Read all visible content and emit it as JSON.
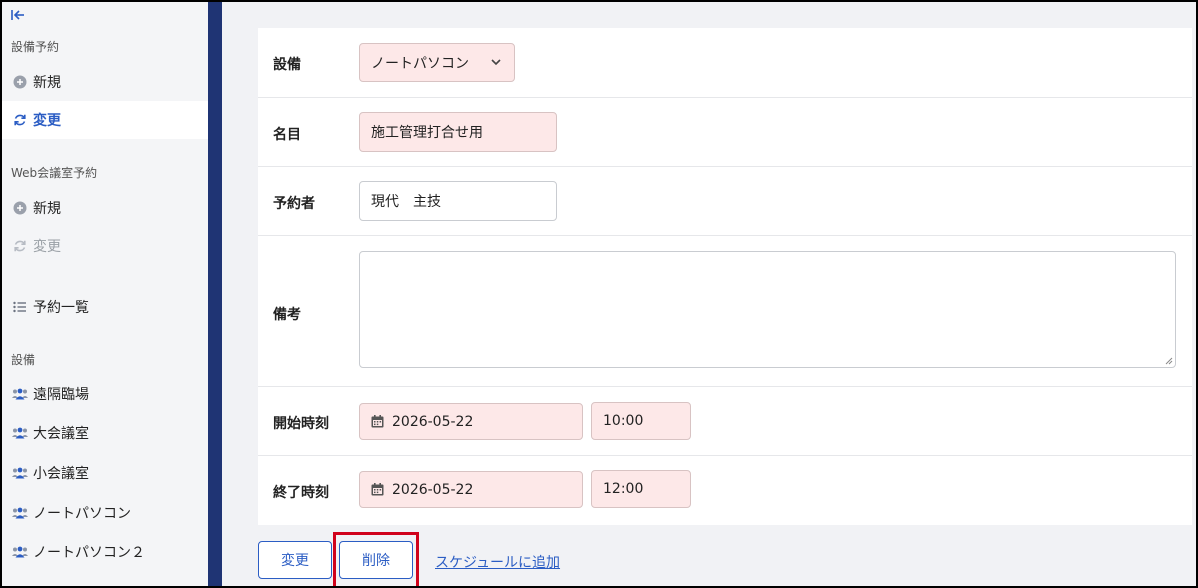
{
  "sidebar": {
    "sections": [
      {
        "title": "設備予約",
        "items": [
          {
            "label": "新規",
            "icon": "plus-circle-icon"
          },
          {
            "label": "変更",
            "icon": "refresh-icon",
            "active": true
          }
        ]
      },
      {
        "title": "Web会議室予約",
        "items": [
          {
            "label": "新規",
            "icon": "plus-circle-icon"
          },
          {
            "label": "変更",
            "icon": "refresh-icon",
            "disabled": true
          }
        ]
      },
      {
        "title": "",
        "items": [
          {
            "label": "予約一覧",
            "icon": "list-icon"
          }
        ]
      },
      {
        "title": "設備",
        "items": [
          {
            "label": "遠隔臨場",
            "icon": "users-icon"
          },
          {
            "label": "大会議室",
            "icon": "users-icon"
          },
          {
            "label": "小会議室",
            "icon": "users-icon"
          },
          {
            "label": "ノートパソコン",
            "icon": "users-icon"
          },
          {
            "label": "ノートパソコン２",
            "icon": "users-icon"
          }
        ]
      }
    ]
  },
  "form": {
    "equipment": {
      "label": "設備",
      "value": "ノートパソコン"
    },
    "name": {
      "label": "名目",
      "value": "施工管理打合せ用"
    },
    "reserver": {
      "label": "予約者",
      "value": "現代　主技"
    },
    "notes": {
      "label": "備考",
      "value": ""
    },
    "start": {
      "label": "開始時刻",
      "date": "2026-05-22",
      "time": "10:00"
    },
    "end": {
      "label": "終了時刻",
      "date": "2026-05-22",
      "time": "12:00"
    }
  },
  "actions": {
    "change_label": "変更",
    "delete_label": "削除",
    "schedule_link": "スケジュールに追加"
  },
  "colors": {
    "accent": "#2b5dc4",
    "sidebar_bar": "#1f3474",
    "required_field_bg": "#fde8e8",
    "highlight": "#d0021b"
  }
}
